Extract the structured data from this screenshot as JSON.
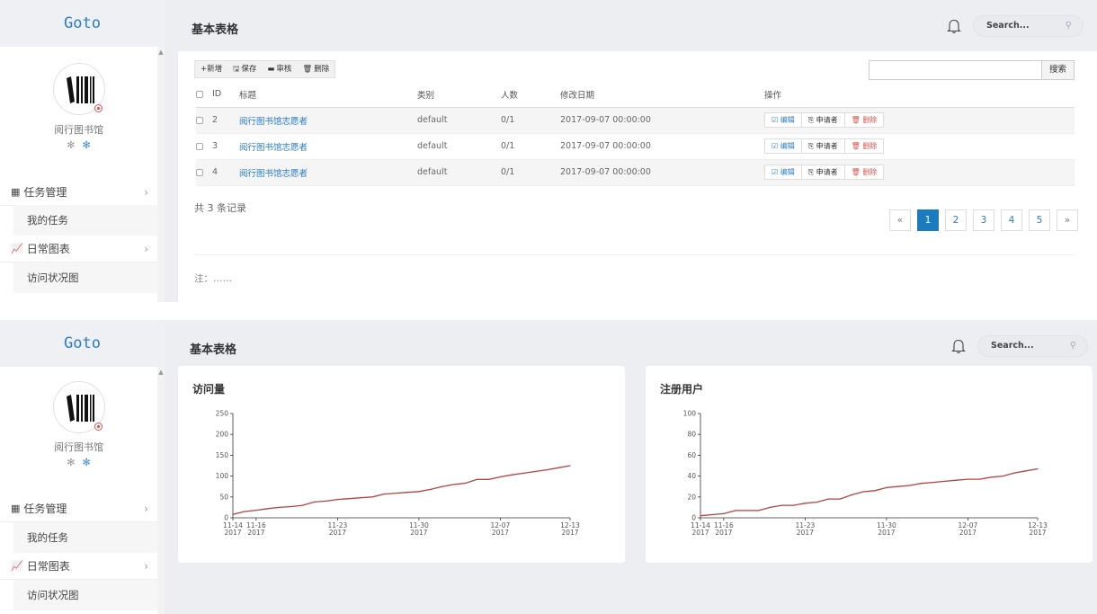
{
  "colors": {
    "accent": "#2a7cc6",
    "active_page": "#1a7bbf",
    "line": "#b54242",
    "delete": "#d9534f"
  },
  "sidebar": {
    "brand": "Goto",
    "library_name": "阅行图书馆",
    "icons": [
      "gear-icon",
      "gear-icon"
    ],
    "menu": [
      {
        "label": "任务管理",
        "icon": "grid-icon",
        "sub": "我的任务"
      },
      {
        "label": "日常图表",
        "icon": "line-chart-icon",
        "sub": "访问状况图"
      }
    ]
  },
  "header": {
    "title": "基本表格",
    "search_placeholder": "Search..."
  },
  "table_view": {
    "toolbar": [
      "+新增",
      "保存",
      "审核",
      "删除"
    ],
    "search_button": "搜索",
    "columns": [
      "ID",
      "标题",
      "类别",
      "人数",
      "修改日期",
      "操作"
    ],
    "rows": [
      {
        "id": "2",
        "title": "阅行图书馆志愿者",
        "category": "default",
        "count": "0/1",
        "date": "2017-09-07 00:00:00"
      },
      {
        "id": "3",
        "title": "阅行图书馆志愿者",
        "category": "default",
        "count": "0/1",
        "date": "2017-09-07 00:00:00"
      },
      {
        "id": "4",
        "title": "阅行图书馆志愿者",
        "category": "default",
        "count": "0/1",
        "date": "2017-09-07 00:00:00"
      }
    ],
    "actions": [
      "编辑",
      "申请者",
      "删除"
    ],
    "record_text": "共 3 条记录",
    "pagination": [
      "«",
      "1",
      "2",
      "3",
      "4",
      "5",
      "»"
    ],
    "active_page": "1",
    "note": "注：……"
  },
  "chart_data": [
    {
      "type": "line",
      "title": "访问量",
      "x": [
        "2017-11-14",
        "2017-11-15",
        "2017-11-16",
        "2017-11-17",
        "2017-11-18",
        "2017-11-19",
        "2017-11-20",
        "2017-11-21",
        "2017-11-22",
        "2017-11-23",
        "2017-11-24",
        "2017-11-25",
        "2017-11-26",
        "2017-11-27",
        "2017-11-28",
        "2017-11-29",
        "2017-11-30",
        "2017-12-01",
        "2017-12-02",
        "2017-12-03",
        "2017-12-04",
        "2017-12-05",
        "2017-12-06",
        "2017-12-07",
        "2017-12-08",
        "2017-12-09",
        "2017-12-10",
        "2017-12-11",
        "2017-12-12",
        "2017-12-13"
      ],
      "y": [
        8,
        15,
        18,
        22,
        25,
        27,
        30,
        38,
        40,
        44,
        46,
        48,
        50,
        57,
        59,
        61,
        63,
        68,
        75,
        80,
        83,
        92,
        92,
        98,
        103,
        107,
        111,
        115,
        120,
        125
      ],
      "xticks": [
        [
          "11-14",
          "2017"
        ],
        [
          "11-16",
          "2017"
        ],
        [
          "11-23",
          "2017"
        ],
        [
          "11-30",
          "2017"
        ],
        [
          "12-07",
          "2017"
        ],
        [
          "12-13",
          "2017"
        ]
      ],
      "yticks": [
        0,
        50,
        100,
        150,
        200,
        250
      ],
      "ylim": [
        0,
        250
      ],
      "grid": false
    },
    {
      "type": "line",
      "title": "注册用户",
      "x": [
        "2017-11-14",
        "2017-11-15",
        "2017-11-16",
        "2017-11-17",
        "2017-11-18",
        "2017-11-19",
        "2017-11-20",
        "2017-11-21",
        "2017-11-22",
        "2017-11-23",
        "2017-11-24",
        "2017-11-25",
        "2017-11-26",
        "2017-11-27",
        "2017-11-28",
        "2017-11-29",
        "2017-11-30",
        "2017-12-01",
        "2017-12-02",
        "2017-12-03",
        "2017-12-04",
        "2017-12-05",
        "2017-12-06",
        "2017-12-07",
        "2017-12-08",
        "2017-12-09",
        "2017-12-10",
        "2017-12-11",
        "2017-12-12",
        "2017-12-13"
      ],
      "y": [
        2,
        3,
        4,
        7,
        7,
        7,
        10,
        12,
        12,
        14,
        15,
        18,
        18,
        22,
        25,
        26,
        29,
        30,
        31,
        33,
        34,
        35,
        36,
        37,
        37,
        39,
        40,
        43,
        45,
        47
      ],
      "xticks": [
        [
          "11-14",
          "2017"
        ],
        [
          "11-16",
          "2017"
        ],
        [
          "11-23",
          "2017"
        ],
        [
          "11-30",
          "2017"
        ],
        [
          "12-07",
          "2017"
        ],
        [
          "12-13",
          "2017"
        ]
      ],
      "yticks": [
        0,
        20,
        40,
        60,
        80,
        100
      ],
      "ylim": [
        0,
        100
      ],
      "grid": false
    }
  ]
}
